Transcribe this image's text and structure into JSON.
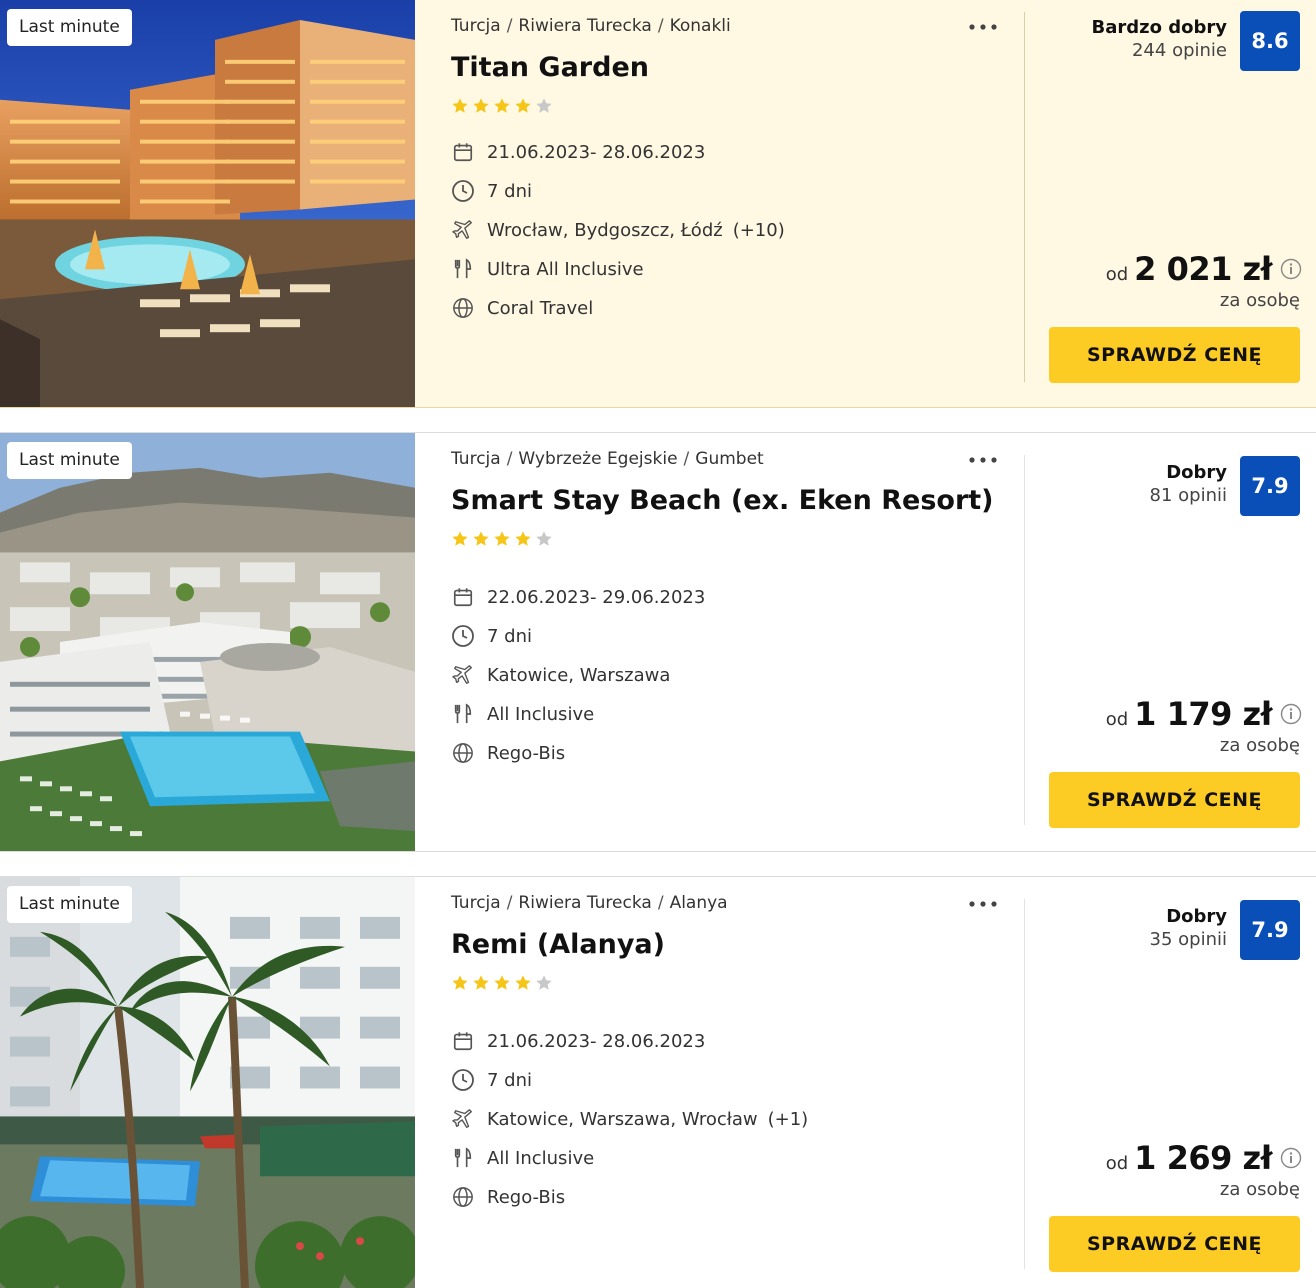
{
  "offers": [
    {
      "badge": "Last minute",
      "breadcrumb": [
        "Turcja",
        "Riwiera Turecka",
        "Konakli"
      ],
      "name": "Titan Garden",
      "stars": 4,
      "dates": "21.06.2023- 28.06.2023",
      "duration": "7 dni",
      "departure": "Wrocław, Bydgoszcz, Łódź",
      "departure_extra": "(+10)",
      "board": "Ultra All Inclusive",
      "operator": "Coral Travel",
      "rating_word": "Bardzo dobry",
      "reviews": "244 opinie",
      "score": "8.6",
      "price_prefix": "od",
      "price": "2 021 zł",
      "price_note": "za osobę",
      "cta": "SPRAWDŹ CENĘ"
    },
    {
      "badge": "Last minute",
      "breadcrumb": [
        "Turcja",
        "Wybrzeże Egejskie",
        "Gumbet"
      ],
      "name": "Smart Stay Beach (ex. Eken Resort)",
      "stars": 4,
      "dates": "22.06.2023- 29.06.2023",
      "duration": "7 dni",
      "departure": "Katowice, Warszawa",
      "departure_extra": "",
      "board": "All Inclusive",
      "operator": "Rego-Bis",
      "rating_word": "Dobry",
      "reviews": "81 opinii",
      "score": "7.9",
      "price_prefix": "od",
      "price": "1 179 zł",
      "price_note": "za osobę",
      "cta": "SPRAWDŹ CENĘ"
    },
    {
      "badge": "Last minute",
      "breadcrumb": [
        "Turcja",
        "Riwiera Turecka",
        "Alanya"
      ],
      "name": "Remi (Alanya)",
      "stars": 4,
      "dates": "21.06.2023- 28.06.2023",
      "duration": "7 dni",
      "departure": "Katowice, Warszawa, Wrocław",
      "departure_extra": "(+1)",
      "board": "All Inclusive",
      "operator": "Rego-Bis",
      "rating_word": "Dobry",
      "reviews": "35 opinii",
      "score": "7.9",
      "price_prefix": "od",
      "price": "1 269 zł",
      "price_note": "za osobę",
      "cta": "SPRAWDŹ CENĘ"
    }
  ],
  "colors": {
    "highlight_bg": "#fff9e4",
    "score_badge": "#0a4fb8",
    "cta_button": "#fccc25",
    "star_filled": "#f5c518",
    "star_empty": "#c8c8c8"
  },
  "icons": [
    "heart-icon",
    "more-dots-icon",
    "star-icon",
    "calendar-icon",
    "clock-icon",
    "plane-icon",
    "cutlery-icon",
    "globe-icon",
    "info-icon"
  ]
}
